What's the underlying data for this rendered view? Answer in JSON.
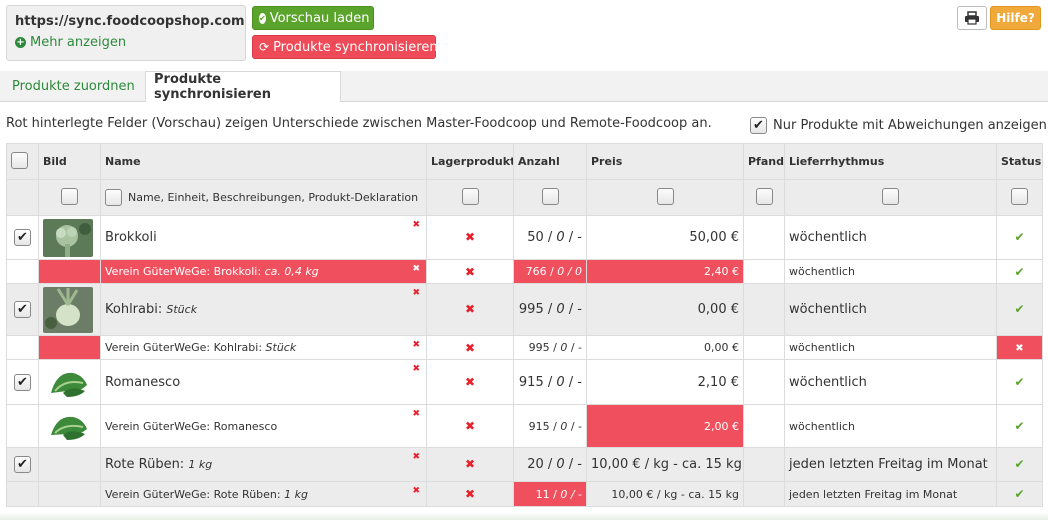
{
  "header": {
    "url": "https://sync.foodcoopshop.com",
    "more_label": "Mehr anzeigen",
    "preview_button": "Vorschau laden",
    "sync_button": "Produkte synchronisieren",
    "help_button": "Hilfe?"
  },
  "tabs": {
    "assign": "Produkte zuordnen",
    "sync": "Produkte synchronisieren"
  },
  "info_text": "Rot hinterlegte Felder (Vorschau) zeigen Unterschiede zwischen Master-Foodcoop und Remote-Foodcoop an.",
  "filter_label": "Nur Produkte mit Abweichungen anzeigen",
  "columns": {
    "image": "Bild",
    "name": "Name",
    "stock": "Lagerprodukt",
    "amount": "Anzahl",
    "price": "Preis",
    "deposit": "Pfand",
    "delivery": "Lieferrhythmus",
    "status": "Status"
  },
  "name_filter_label": "Name, Einheit, Beschreibungen, Produkt-Deklaration",
  "products": [
    {
      "master": {
        "name": "Brokkoli",
        "unit": "",
        "amount": "50 / ",
        "amount_i1": "0",
        "amount_sep": " / -",
        "price": "50,00 €",
        "delivery": "wöchentlich"
      },
      "remote": {
        "name": "Verein GüterWeGe: Brokkoli: ",
        "unit": "ca. 0,4 kg",
        "amount": "766 / ",
        "amount_i1": "0",
        "amount_sep": " / 0",
        "price": "2,40 €",
        "delivery": "wöchentlich"
      }
    },
    {
      "master": {
        "name": "Kohlrabi: ",
        "unit": "Stück",
        "amount": "995 / ",
        "amount_i1": "0",
        "amount_sep": " / -",
        "price": "0,00 €",
        "delivery": "wöchentlich"
      },
      "remote": {
        "name": "Verein GüterWeGe: Kohlrabi: ",
        "unit": "Stück",
        "amount": "995 / ",
        "amount_i1": "0",
        "amount_sep": " / -",
        "price": "0,00 €",
        "delivery": "wöchentlich"
      }
    },
    {
      "master": {
        "name": "Romanesco",
        "unit": "",
        "amount": "915 / ",
        "amount_i1": "0",
        "amount_sep": " / -",
        "price": "2,10 €",
        "delivery": "wöchentlich"
      },
      "remote": {
        "name": "Verein GüterWeGe: Romanesco",
        "unit": "",
        "amount": "915 / ",
        "amount_i1": "0",
        "amount_sep": " / -",
        "price": "2,00 €",
        "delivery": "wöchentlich"
      }
    },
    {
      "master": {
        "name": "Rote Rüben: ",
        "unit": "1 kg",
        "amount": "20 / ",
        "amount_i1": "0",
        "amount_sep": " / -",
        "price": "10,00 € / kg - ca. 15 kg",
        "delivery": "jeden letzten Freitag im Monat"
      },
      "remote": {
        "name": "Verein GüterWeGe: Rote Rüben: ",
        "unit": "1 kg",
        "amount": "11 / ",
        "amount_i1": "0",
        "amount_sep": " / -",
        "price": "10,00 € / kg - ca. 15 kg",
        "delivery": "jeden letzten Freitag im Monat"
      }
    }
  ],
  "colors": {
    "green": "#5aa42c",
    "red": "#f0505e",
    "orange": "#f0a93a"
  }
}
